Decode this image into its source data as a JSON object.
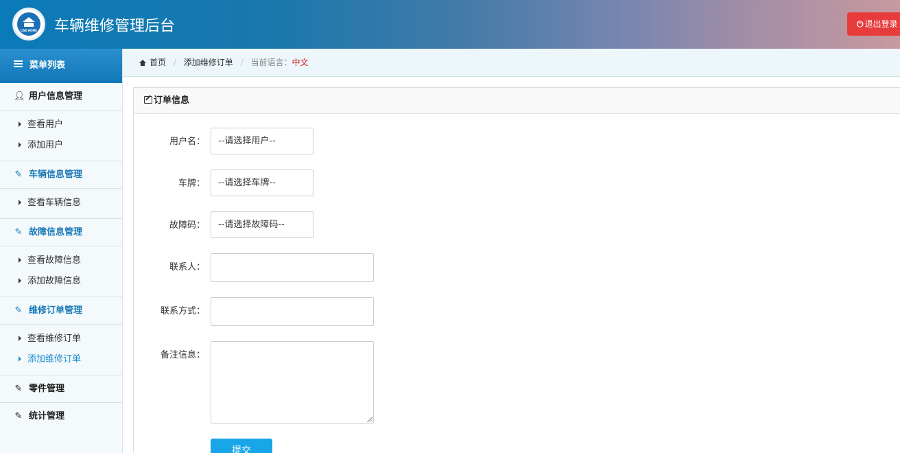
{
  "header": {
    "logo_text": "CAR HOME",
    "title": "车辆维修管理后台",
    "logout_label": "退出登录",
    "logout_icon": "power-icon"
  },
  "sidebar": {
    "menu_title": "菜单列表",
    "groups": [
      {
        "label": "用户信息管理",
        "icon": "user-icon",
        "items": [
          "查看用户",
          "添加用户"
        ]
      },
      {
        "label": "车辆信息管理",
        "icon": "edit-icon",
        "items": [
          "查看车辆信息"
        ]
      },
      {
        "label": "故障信息管理",
        "icon": "edit-icon",
        "items": [
          "查看故障信息",
          "添加故障信息"
        ]
      },
      {
        "label": "维修订单管理",
        "icon": "edit-icon",
        "items": [
          "查看维修订单",
          "添加维修订单"
        ]
      },
      {
        "label": "零件管理",
        "icon": "edit-icon",
        "items": []
      },
      {
        "label": "统计管理",
        "icon": "edit-icon",
        "items": []
      }
    ],
    "active_item": "添加维修订单",
    "accent_color": "#1a7ab8"
  },
  "breadcrumb": {
    "home": "首页",
    "current": "添加维修订单",
    "lang_label": "当前语言：",
    "lang_value": "中文"
  },
  "panel": {
    "title": "订单信息"
  },
  "form": {
    "username_label": "用户名：",
    "username_select": "--请选择用户--",
    "plate_label": "车牌：",
    "plate_select": "--请选择车牌--",
    "fault_label": "故障码：",
    "fault_select": "--请选择故障码--",
    "contact_label": "联系人：",
    "contact_value": "",
    "phone_label": "联系方式：",
    "phone_value": "",
    "remark_label": "备注信息：",
    "remark_value": "",
    "submit_label": "提交"
  }
}
